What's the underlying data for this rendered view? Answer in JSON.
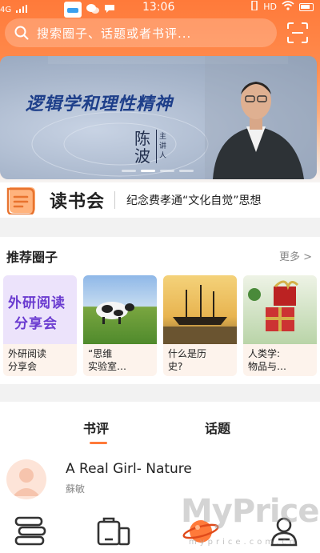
{
  "status_bar": {
    "signal": "4G",
    "time": "13:06",
    "hd": "HD"
  },
  "search": {
    "placeholder": "搜索圈子、话题或者书评..."
  },
  "banner": {
    "title": "逻辑学和理性精神",
    "speaker_name": "陈波",
    "speaker_role": "主讲人",
    "page_count": 4,
    "active_page": 1
  },
  "notice": {
    "brand": "读书会",
    "text": "纪念费孝通“文化自觉”思想"
  },
  "circles": {
    "title": "推荐圈子",
    "more": "更多 >",
    "cards": [
      {
        "image_text_line1": "外研阅读",
        "image_text_line2": "分享会",
        "label": "外研阅读\n分享会"
      },
      {
        "label": "“思维\n实验室…"
      },
      {
        "label": "什么是历\n史?"
      },
      {
        "label": "人类学:\n物品与…"
      }
    ]
  },
  "tabs": {
    "review": "书评",
    "topic": "话题",
    "active": "review"
  },
  "post": {
    "title": "A Real Girl- Nature",
    "author": "蘇敏"
  },
  "watermark": {
    "brand": "MyPrice",
    "url": "myprice.com.cn"
  },
  "colors": {
    "accent": "#ff7a3a",
    "banner_title": "#1e3f8a"
  },
  "icons": {
    "nav": [
      "books-icon",
      "shop-icon",
      "planet-icon",
      "profile-icon"
    ]
  }
}
